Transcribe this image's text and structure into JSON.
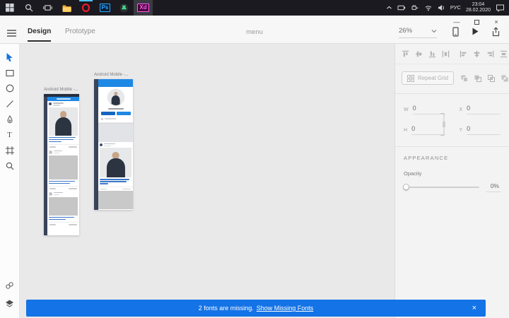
{
  "taskbar": {
    "apps": {
      "photoshop": "Ps",
      "xd": "Xd"
    },
    "tray": {
      "language": "РУС",
      "time": "23:04",
      "date": "28.02.2020"
    }
  },
  "header": {
    "tabs": {
      "design": "Design",
      "prototype": "Prototype"
    },
    "document_title": "menu",
    "zoom_level": "26%"
  },
  "icons": {
    "minimize": "—",
    "close_window": "×",
    "toast_close": "×",
    "text_tool": "T"
  },
  "artboards": [
    {
      "label": "Android Mobile -..."
    },
    {
      "label": "Android Mobile -..."
    }
  ],
  "inspector": {
    "repeat_grid": "Repeat Grid",
    "transform": {
      "w": {
        "label": "W",
        "value": "0"
      },
      "h": {
        "label": "H",
        "value": "0"
      },
      "x": {
        "label": "X",
        "value": "0"
      },
      "y": {
        "label": "Y",
        "value": "0"
      }
    },
    "appearance": {
      "title": "APPEARANCE",
      "opacity_label": "Opacity",
      "opacity_value": "0%"
    }
  },
  "notification": {
    "message": "2 fonts are missing.",
    "link": "Show Missing Fonts"
  },
  "colors": {
    "accent": "#1473e6",
    "artboard_blue": "#1e88e5",
    "taskbar": "#1a1a20"
  }
}
